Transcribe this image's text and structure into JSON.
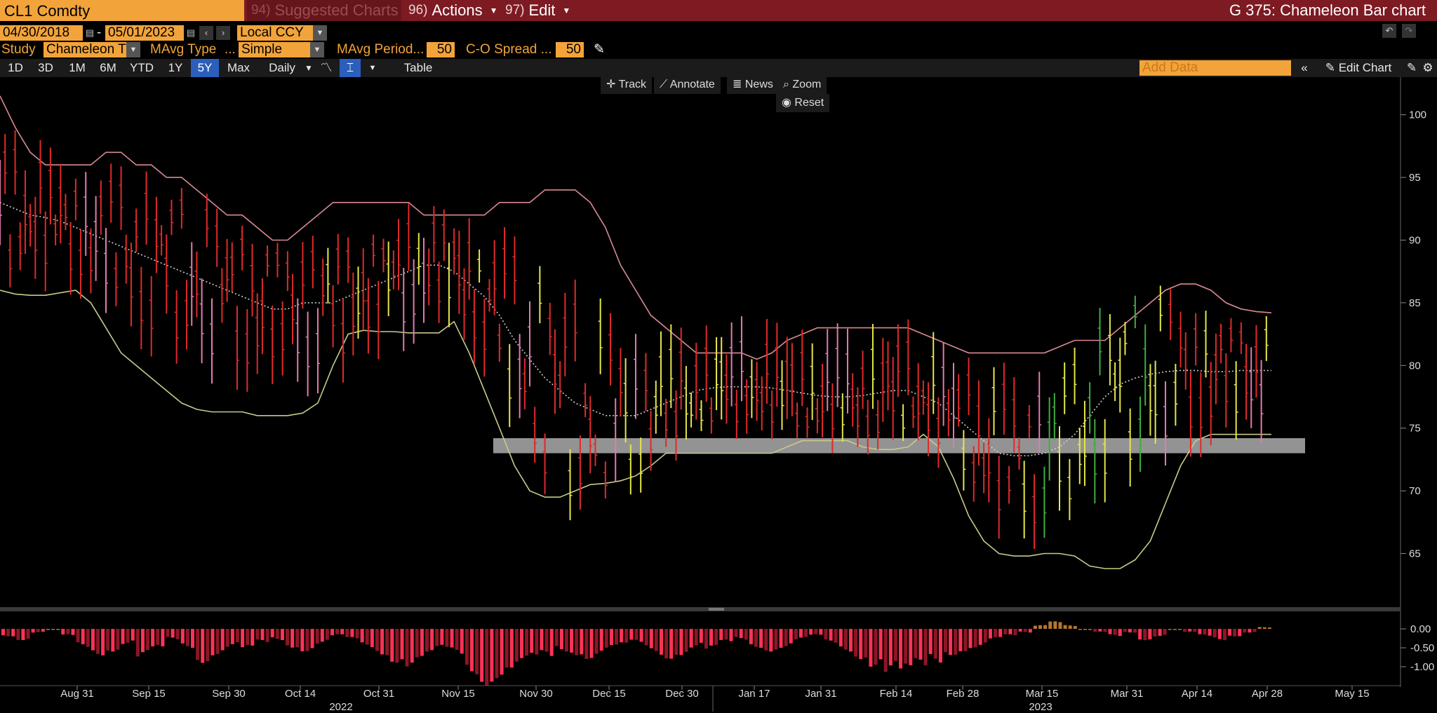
{
  "toolbar": {
    "ticker": "CL1 Comdty",
    "suggested": {
      "num": "94)",
      "label": "Suggested Charts"
    },
    "actions": {
      "num": "96)",
      "label": "Actions"
    },
    "edit": {
      "num": "97)",
      "label": "Edit"
    },
    "title": "G 375: Chameleon Bar chart"
  },
  "params": {
    "start_date": "04/30/2018",
    "end_date": "05/01/2023",
    "currency": "Local CCY",
    "study_label": "Study",
    "study_value": "Chameleon T",
    "mavg_type_label": "MAvg Type",
    "mavg_type_ellipsis": "...",
    "mavg_type_value": "Simple",
    "mavg_period_label": "MAvg Period...",
    "mavg_period_value": "50",
    "spread_label": "C-O Spread ...",
    "spread_value": "50"
  },
  "range_bar": {
    "ranges": [
      "1D",
      "3D",
      "1M",
      "6M",
      "YTD",
      "1Y",
      "5Y",
      "Max"
    ],
    "selected": "5Y",
    "frequency": "Daily",
    "table": "Table",
    "add_data_placeholder": "Add Data",
    "edit_chart": "Edit Chart"
  },
  "chart_tools": {
    "track": "Track",
    "annotate": "Annotate",
    "news": "News",
    "zoom": "Zoom",
    "reset": "Reset"
  },
  "colors": {
    "brand_bar": "#7d1a22",
    "accent_orange": "#f2a43a",
    "selected_blue": "#2b5fbb",
    "upper_band": "#d98a93",
    "lower_band": "#c9c98a",
    "mavg": "#cfcfcf",
    "bar_red": "#e02a2a",
    "bar_pink": "#e27ab0",
    "bar_yellow": "#e6e64a",
    "bar_green": "#3fae3f"
  },
  "chart_data": [
    {
      "type": "line",
      "title": "",
      "y_ticks": [
        "100",
        "95",
        "90",
        "85",
        "80",
        "75",
        "70",
        "65"
      ],
      "ylim": [
        60.5,
        103
      ],
      "x_ticks": [
        "Aug 31",
        "Sep 15",
        "Sep 30",
        "Oct 14",
        "Oct 31",
        "Nov 15",
        "Nov 30",
        "Dec 15",
        "Dec 30",
        "Jan 17",
        "Jan 31",
        "Feb 14",
        "Feb 28",
        "Mar 15",
        "Mar 31",
        "Apr 14",
        "Apr 28",
        "May 15"
      ],
      "year_labels": [
        "2022",
        "2023"
      ],
      "series": [
        {
          "name": "",
          "role": "upper",
          "values": [
            101.5,
            99,
            97,
            96,
            96,
            96,
            96,
            97,
            97,
            96,
            96,
            95,
            95,
            94,
            93,
            92,
            92,
            91,
            90,
            90,
            91,
            92,
            93,
            93,
            93,
            93,
            93,
            93,
            92,
            92,
            92,
            92,
            92,
            93,
            93,
            93,
            94,
            94,
            94,
            93,
            91,
            88,
            86,
            84,
            83,
            82,
            81,
            81,
            81,
            81,
            80.5,
            81,
            82,
            82.5,
            83,
            83,
            83,
            83,
            83,
            83,
            83,
            82.5,
            82,
            81.5,
            81,
            81,
            81,
            81,
            81,
            81,
            81.5,
            82,
            82,
            82,
            83,
            84,
            85,
            86,
            86.5,
            86.5,
            86,
            85,
            84.5,
            84.3,
            84.2
          ]
        },
        {
          "name": "",
          "role": "mavg",
          "values": [
            93,
            92.5,
            92,
            91.8,
            91.5,
            91,
            90.5,
            90,
            89.5,
            89,
            88.5,
            88,
            87.5,
            87,
            86.5,
            86,
            85.5,
            85,
            84.5,
            84.5,
            85,
            85,
            85,
            85.5,
            86,
            86.5,
            87,
            87.5,
            88,
            88,
            87.5,
            86.5,
            85.5,
            84,
            82,
            80.5,
            79,
            78,
            77,
            76.5,
            76,
            76,
            76,
            76.5,
            77,
            77.5,
            78,
            78.2,
            78.3,
            78.3,
            78.3,
            78.2,
            78,
            77.8,
            77.6,
            77.5,
            77.5,
            77.6,
            77.8,
            78,
            78,
            77.5,
            77,
            76,
            75,
            74,
            73,
            72.8,
            72.8,
            73,
            73.5,
            74.5,
            76,
            77.5,
            78.5,
            79,
            79.3,
            79.5,
            79.6,
            79.6,
            79.5,
            79.5,
            79.6,
            79.6,
            79.6
          ]
        },
        {
          "name": "",
          "role": "lower",
          "values": [
            86,
            85.7,
            85.6,
            85.6,
            85.8,
            86,
            85,
            83,
            81,
            80,
            79,
            78,
            77,
            76.5,
            76.3,
            76.3,
            76.3,
            76,
            76,
            76,
            76.2,
            77,
            80,
            82.5,
            82.8,
            82.7,
            82.7,
            82.6,
            82.6,
            82.6,
            83.5,
            81,
            78,
            75,
            72,
            70,
            69.5,
            69.5,
            70,
            70.5,
            70.6,
            70.8,
            71.2,
            72,
            73,
            73,
            73,
            73,
            73,
            73,
            73,
            73,
            73.5,
            74,
            74,
            74,
            74,
            73.5,
            73.3,
            73.3,
            73.5,
            74.5,
            73.5,
            71,
            68,
            66,
            65,
            64.8,
            64.8,
            65,
            65,
            64.8,
            64,
            63.8,
            63.8,
            64.5,
            66,
            69,
            72,
            74,
            74.5,
            74.5,
            74.5,
            74.5,
            74.5
          ]
        },
        {
          "name": "",
          "role": "spread_hist",
          "values": [
            -0.2,
            -0.3,
            -0.1,
            0,
            -0.2,
            -0.5,
            -0.7,
            -0.6,
            -0.4,
            -0.8,
            -0.6,
            -0.3,
            -0.5,
            -0.9,
            -0.7,
            -0.5,
            -0.6,
            -0.4,
            -0.3,
            -0.5,
            -0.6,
            -0.4,
            -0.2,
            -0.3,
            -0.5,
            -0.7,
            -0.9,
            -1.0,
            -0.8,
            -0.6,
            -0.7,
            -1.2,
            -1.5,
            -1.3,
            -1.1,
            -0.9,
            -0.8,
            -0.6,
            -0.7,
            -0.8,
            -0.6,
            -0.5,
            -0.4,
            -0.6,
            -0.8,
            -0.7,
            -0.5,
            -0.6,
            -0.4,
            -0.3,
            -0.5,
            -0.6,
            -0.5,
            -0.3,
            -0.2,
            -0.4,
            -0.6,
            -0.8,
            -1.0,
            -1.2,
            -1.3,
            -1.1,
            -0.9,
            -0.7,
            -0.6,
            -0.5,
            -0.3,
            -0.2,
            -0.1,
            0.1,
            0.2,
            0.1,
            0,
            -0.1,
            -0.2,
            -0.1,
            -0.3,
            -0.2,
            0,
            -0.1,
            -0.2,
            -0.3,
            -0.2,
            -0.1,
            0.05
          ]
        }
      ],
      "channel_band": [
        73,
        74.2
      ]
    }
  ]
}
